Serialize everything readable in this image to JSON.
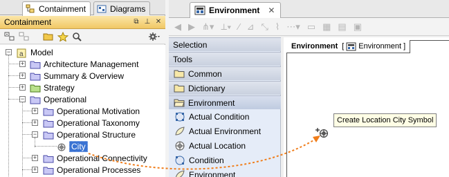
{
  "left_panel": {
    "tabs": [
      {
        "label": "Containment",
        "icon": "containment-tab-icon",
        "active": true
      },
      {
        "label": "Diagrams",
        "icon": "diagrams-tab-icon",
        "active": false
      }
    ],
    "panel_title": "Containment",
    "tree": {
      "root": "Model",
      "items": [
        {
          "label": "Architecture Management"
        },
        {
          "label": "Summary & Overview"
        },
        {
          "label": "Strategy"
        },
        {
          "label": "Operational"
        },
        {
          "label": "Operational Motivation"
        },
        {
          "label": "Operational Taxonomy"
        },
        {
          "label": "Operational Structure"
        },
        {
          "label": "City"
        },
        {
          "label": "Operational Connectivity"
        },
        {
          "label": "Operational Processes"
        }
      ]
    }
  },
  "diagram": {
    "tab_label": "Environment",
    "frame_name": "Environment",
    "frame_type": "Environment",
    "tooltip": "Create Location City Symbol"
  },
  "palette": {
    "items": [
      {
        "label": "Selection",
        "kind": "header"
      },
      {
        "label": "Tools",
        "kind": "header"
      },
      {
        "label": "Common",
        "kind": "group"
      },
      {
        "label": "Dictionary",
        "kind": "group"
      },
      {
        "label": "Environment",
        "kind": "group"
      },
      {
        "label": "Actual Condition",
        "kind": "element",
        "icon": "actual-condition-icon"
      },
      {
        "label": "Actual Environment",
        "kind": "element",
        "icon": "actual-environment-icon"
      },
      {
        "label": "Actual Location",
        "kind": "element",
        "icon": "actual-location-icon"
      },
      {
        "label": "Condition",
        "kind": "element",
        "icon": "condition-icon"
      },
      {
        "label": "Environment",
        "kind": "element",
        "icon": "environment-icon"
      }
    ]
  },
  "colors": {
    "panel_header": "#f1c865",
    "selection": "#3a73d3",
    "drag_arrow": "#f07d1a",
    "palette_bg": "#e5ecf8",
    "folder_fill": "#c9c8f5",
    "package_fill": "#b9e08a"
  }
}
